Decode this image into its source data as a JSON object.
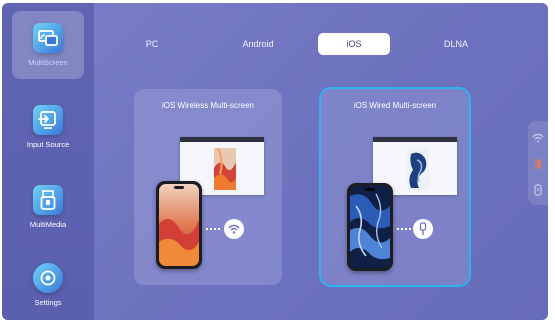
{
  "sidebar": {
    "items": [
      {
        "label": "MultiScreen",
        "icon": "multiscreen-icon",
        "active": true
      },
      {
        "label": "Input Source",
        "icon": "input-source-icon",
        "active": false
      },
      {
        "label": "MultiMedia",
        "icon": "usb-drive-icon",
        "active": false
      },
      {
        "label": "Settings",
        "icon": "settings-icon",
        "active": false
      }
    ]
  },
  "tabs": [
    {
      "label": "PC",
      "active": false
    },
    {
      "label": "Android",
      "active": false
    },
    {
      "label": "iOS",
      "active": true
    },
    {
      "label": "DLNA",
      "active": false
    }
  ],
  "cards": [
    {
      "title": "iOS Wireless Multi-screen",
      "connection_icon": "wifi-icon",
      "selected": false
    },
    {
      "title": "iOS Wired Multi-screen",
      "connection_icon": "usb-cable-icon",
      "selected": true
    }
  ],
  "status_icons": [
    "wifi-icon",
    "bluetooth-icon",
    "usb-icon"
  ],
  "colors": {
    "accent_selected": "#2fb2f0",
    "background": "#6f74bf",
    "icon_gradient_start": "#6fd3f6",
    "icon_gradient_end": "#3a78d8"
  }
}
